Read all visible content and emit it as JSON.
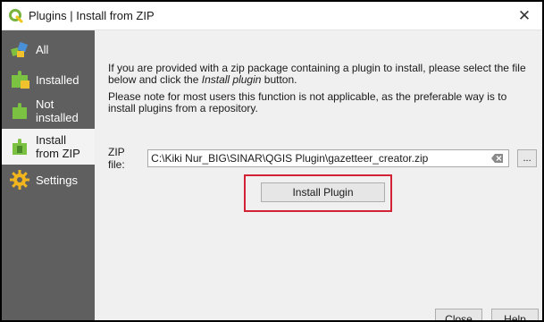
{
  "window": {
    "title": "Plugins | Install from ZIP",
    "close_glyph": "✕"
  },
  "sidebar": {
    "items": [
      {
        "label": "All",
        "icon": "all-plugins-icon",
        "active": false
      },
      {
        "label": "Installed",
        "icon": "installed-plugins-icon",
        "active": false
      },
      {
        "label": "Not installed",
        "icon": "not-installed-plugins-icon",
        "active": false
      },
      {
        "label": "Install from ZIP",
        "icon": "install-zip-icon",
        "active": true
      },
      {
        "label": "Settings",
        "icon": "settings-icon",
        "active": false
      }
    ]
  },
  "content": {
    "intro_part1": "If you are provided with a zip package containing a plugin to install, please select the file below and click the ",
    "intro_emph": "Install plugin",
    "intro_part2": " button.",
    "note": "Please note for most users this function is not applicable, as the preferable way is to install plugins from a repository.",
    "zip_label": "ZIP file:",
    "zip_value": "C:\\Kiki Nur_BIG\\SINAR\\QGIS Plugin\\gazetteer_creator.zip",
    "browse_label": "...",
    "install_button": "Install Plugin"
  },
  "footer": {
    "close_button": "Close",
    "help_button": "Help"
  },
  "colors": {
    "sidebar_bg": "#5f5f5f",
    "highlight_border": "#d32236",
    "qgis_green": "#77b33e"
  }
}
